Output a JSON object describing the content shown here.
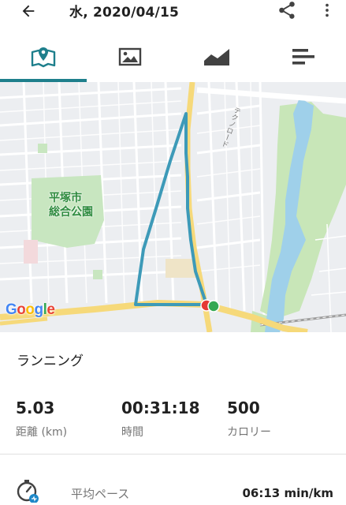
{
  "header": {
    "title": "水, 2020/04/15",
    "back_icon": "arrow-back-icon",
    "share_icon": "share-icon",
    "more_icon": "more-vert-icon"
  },
  "tabs": [
    {
      "name": "map",
      "icon": "map-icon",
      "selected": true
    },
    {
      "name": "photos",
      "icon": "image-icon",
      "selected": false
    },
    {
      "name": "chart",
      "icon": "area-chart-icon",
      "selected": false
    },
    {
      "name": "details",
      "icon": "list-icon",
      "selected": false
    }
  ],
  "map": {
    "park_label": "平塚市\n総合公園",
    "road_label": "テクノロード",
    "attribution": "Google"
  },
  "activity": {
    "type": "ランニング"
  },
  "stats": [
    {
      "value": "5.03",
      "label": "距離 (km)"
    },
    {
      "value": "00:31:18",
      "label": "時間"
    },
    {
      "value": "500",
      "label": "カロリー"
    }
  ],
  "pace": {
    "label": "平均ペース",
    "value": "06:13 min/km"
  },
  "colors": {
    "accent": "#1e7f8c",
    "route": "#3d9ab8",
    "start_marker": "#34a853",
    "end_marker": "#e53935"
  }
}
